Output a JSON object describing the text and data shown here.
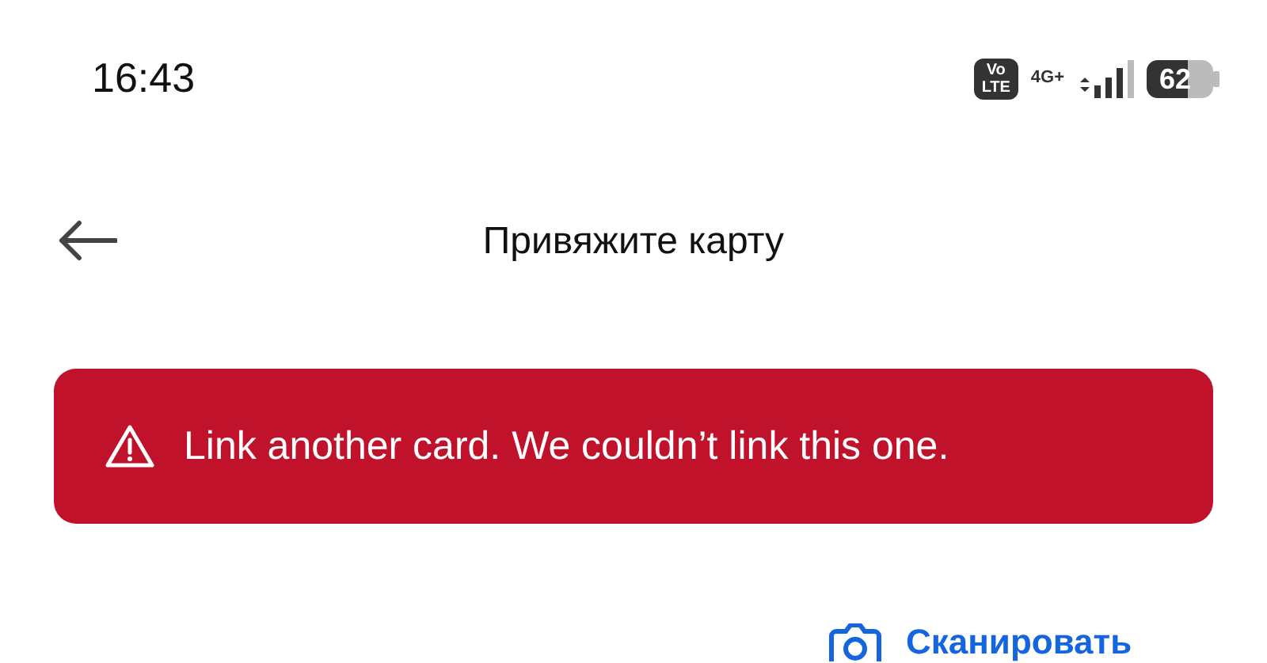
{
  "status_bar": {
    "time": "16:43",
    "volte": "Vo LTE",
    "network": "4G+",
    "battery": "62"
  },
  "header": {
    "title": "Привяжите карту"
  },
  "error_banner": {
    "message": "Link another card. We couldn’t link this one."
  },
  "scan_button": {
    "label": "Сканировать"
  }
}
